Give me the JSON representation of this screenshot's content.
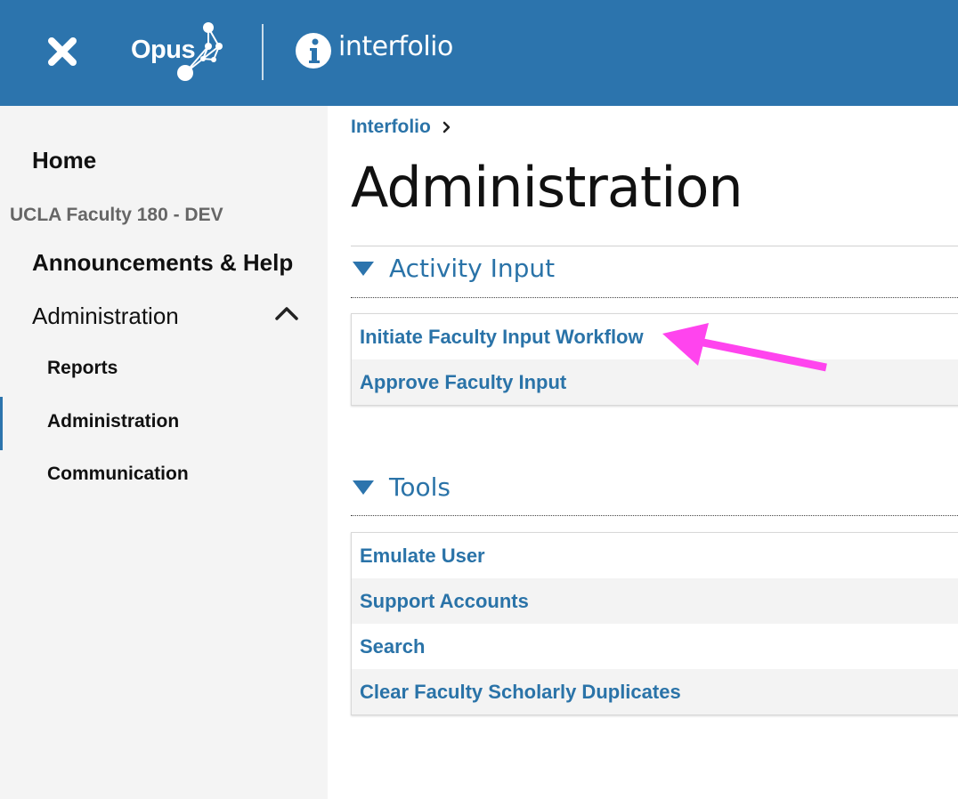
{
  "header": {
    "close_icon": "close-icon",
    "app_logo_text": "Opus",
    "partner_logo_text": "interfolio",
    "brand_color": "#2c74ad"
  },
  "sidebar": {
    "home": "Home",
    "context": "UCLA Faculty 180 - DEV",
    "announcements": "Announcements & Help",
    "administration": "Administration",
    "sub_items": [
      "Reports",
      "Administration",
      "Communication"
    ],
    "active_item": "Administration"
  },
  "main": {
    "breadcrumb": "Interfolio",
    "title": "Administration",
    "sections": [
      {
        "title": "Activity Input",
        "links": [
          "Initiate Faculty Input Workflow",
          "Approve Faculty Input"
        ]
      },
      {
        "title": "Tools",
        "links": [
          "Emulate User",
          "Support Accounts",
          "Search",
          "Clear Faculty Scholarly Duplicates"
        ]
      }
    ]
  },
  "annotation": {
    "arrow_color": "#ff44ee"
  }
}
